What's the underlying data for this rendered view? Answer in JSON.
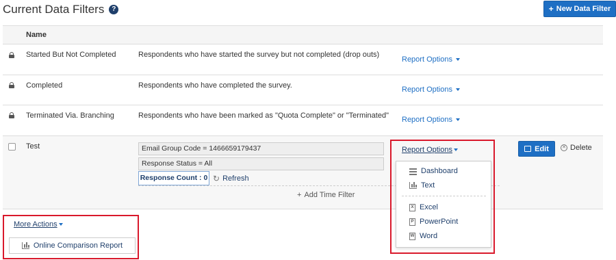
{
  "page": {
    "title": "Current Data Filters",
    "help_glyph": "?",
    "new_filter_label": "New Data Filter"
  },
  "table": {
    "header_name": "Name",
    "rows": [
      {
        "name": "Started But Not Completed",
        "description": "Respondents who have started the survey but not completed (drop outs)",
        "report_options": "Report Options",
        "locked": true
      },
      {
        "name": "Completed",
        "description": "Respondents who have completed the survey.",
        "report_options": "Report Options",
        "locked": true
      },
      {
        "name": "Terminated Via. Branching",
        "description": "Respondents who have been marked as \"Quota Complete\" or \"Terminated\"",
        "report_options": "Report Options",
        "locked": true
      }
    ],
    "custom_row": {
      "name": "Test",
      "conditions": [
        "Email Group Code = 1466659179437",
        "Response Status = All"
      ],
      "response_count": "Response Count : 0",
      "refresh_label": "Refresh",
      "add_time_filter": "Add Time Filter",
      "report_options": "Report Options",
      "edit_label": "Edit",
      "delete_label": "Delete"
    }
  },
  "report_menu": {
    "items": [
      {
        "label": "Dashboard",
        "icon": "dashboard-icon"
      },
      {
        "label": "Text",
        "icon": "bar-chart-icon"
      },
      {
        "label": "Excel",
        "icon": "excel-file-icon",
        "glyph": "X"
      },
      {
        "label": "PowerPoint",
        "icon": "powerpoint-file-icon",
        "glyph": "P"
      },
      {
        "label": "Word",
        "icon": "word-file-icon",
        "glyph": "W"
      }
    ]
  },
  "footer": {
    "more_actions": "More Actions",
    "comparison_report": "Online Comparison Report"
  },
  "colors": {
    "primary_button": "#1e6fc4",
    "link": "#1f3f6b",
    "highlight_box": "#d9182b"
  }
}
